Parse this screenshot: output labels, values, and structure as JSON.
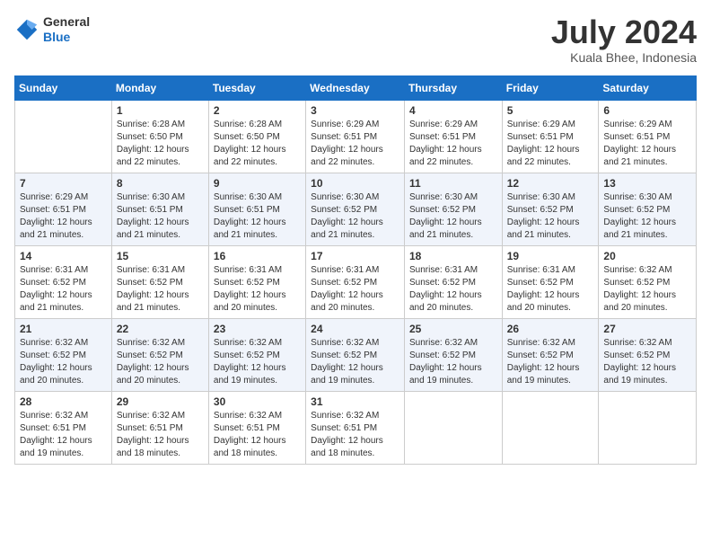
{
  "header": {
    "logo": {
      "general": "General",
      "blue": "Blue"
    },
    "title": "July 2024",
    "location": "Kuala Bhee, Indonesia"
  },
  "columns": [
    "Sunday",
    "Monday",
    "Tuesday",
    "Wednesday",
    "Thursday",
    "Friday",
    "Saturday"
  ],
  "weeks": [
    [
      {
        "num": "",
        "info": ""
      },
      {
        "num": "1",
        "info": "Sunrise: 6:28 AM\nSunset: 6:50 PM\nDaylight: 12 hours\nand 22 minutes."
      },
      {
        "num": "2",
        "info": "Sunrise: 6:28 AM\nSunset: 6:50 PM\nDaylight: 12 hours\nand 22 minutes."
      },
      {
        "num": "3",
        "info": "Sunrise: 6:29 AM\nSunset: 6:51 PM\nDaylight: 12 hours\nand 22 minutes."
      },
      {
        "num": "4",
        "info": "Sunrise: 6:29 AM\nSunset: 6:51 PM\nDaylight: 12 hours\nand 22 minutes."
      },
      {
        "num": "5",
        "info": "Sunrise: 6:29 AM\nSunset: 6:51 PM\nDaylight: 12 hours\nand 22 minutes."
      },
      {
        "num": "6",
        "info": "Sunrise: 6:29 AM\nSunset: 6:51 PM\nDaylight: 12 hours\nand 21 minutes."
      }
    ],
    [
      {
        "num": "7",
        "info": "Sunrise: 6:29 AM\nSunset: 6:51 PM\nDaylight: 12 hours\nand 21 minutes."
      },
      {
        "num": "8",
        "info": "Sunrise: 6:30 AM\nSunset: 6:51 PM\nDaylight: 12 hours\nand 21 minutes."
      },
      {
        "num": "9",
        "info": "Sunrise: 6:30 AM\nSunset: 6:51 PM\nDaylight: 12 hours\nand 21 minutes."
      },
      {
        "num": "10",
        "info": "Sunrise: 6:30 AM\nSunset: 6:52 PM\nDaylight: 12 hours\nand 21 minutes."
      },
      {
        "num": "11",
        "info": "Sunrise: 6:30 AM\nSunset: 6:52 PM\nDaylight: 12 hours\nand 21 minutes."
      },
      {
        "num": "12",
        "info": "Sunrise: 6:30 AM\nSunset: 6:52 PM\nDaylight: 12 hours\nand 21 minutes."
      },
      {
        "num": "13",
        "info": "Sunrise: 6:30 AM\nSunset: 6:52 PM\nDaylight: 12 hours\nand 21 minutes."
      }
    ],
    [
      {
        "num": "14",
        "info": "Sunrise: 6:31 AM\nSunset: 6:52 PM\nDaylight: 12 hours\nand 21 minutes."
      },
      {
        "num": "15",
        "info": "Sunrise: 6:31 AM\nSunset: 6:52 PM\nDaylight: 12 hours\nand 21 minutes."
      },
      {
        "num": "16",
        "info": "Sunrise: 6:31 AM\nSunset: 6:52 PM\nDaylight: 12 hours\nand 20 minutes."
      },
      {
        "num": "17",
        "info": "Sunrise: 6:31 AM\nSunset: 6:52 PM\nDaylight: 12 hours\nand 20 minutes."
      },
      {
        "num": "18",
        "info": "Sunrise: 6:31 AM\nSunset: 6:52 PM\nDaylight: 12 hours\nand 20 minutes."
      },
      {
        "num": "19",
        "info": "Sunrise: 6:31 AM\nSunset: 6:52 PM\nDaylight: 12 hours\nand 20 minutes."
      },
      {
        "num": "20",
        "info": "Sunrise: 6:32 AM\nSunset: 6:52 PM\nDaylight: 12 hours\nand 20 minutes."
      }
    ],
    [
      {
        "num": "21",
        "info": "Sunrise: 6:32 AM\nSunset: 6:52 PM\nDaylight: 12 hours\nand 20 minutes."
      },
      {
        "num": "22",
        "info": "Sunrise: 6:32 AM\nSunset: 6:52 PM\nDaylight: 12 hours\nand 20 minutes."
      },
      {
        "num": "23",
        "info": "Sunrise: 6:32 AM\nSunset: 6:52 PM\nDaylight: 12 hours\nand 19 minutes."
      },
      {
        "num": "24",
        "info": "Sunrise: 6:32 AM\nSunset: 6:52 PM\nDaylight: 12 hours\nand 19 minutes."
      },
      {
        "num": "25",
        "info": "Sunrise: 6:32 AM\nSunset: 6:52 PM\nDaylight: 12 hours\nand 19 minutes."
      },
      {
        "num": "26",
        "info": "Sunrise: 6:32 AM\nSunset: 6:52 PM\nDaylight: 12 hours\nand 19 minutes."
      },
      {
        "num": "27",
        "info": "Sunrise: 6:32 AM\nSunset: 6:52 PM\nDaylight: 12 hours\nand 19 minutes."
      }
    ],
    [
      {
        "num": "28",
        "info": "Sunrise: 6:32 AM\nSunset: 6:51 PM\nDaylight: 12 hours\nand 19 minutes."
      },
      {
        "num": "29",
        "info": "Sunrise: 6:32 AM\nSunset: 6:51 PM\nDaylight: 12 hours\nand 18 minutes."
      },
      {
        "num": "30",
        "info": "Sunrise: 6:32 AM\nSunset: 6:51 PM\nDaylight: 12 hours\nand 18 minutes."
      },
      {
        "num": "31",
        "info": "Sunrise: 6:32 AM\nSunset: 6:51 PM\nDaylight: 12 hours\nand 18 minutes."
      },
      {
        "num": "",
        "info": ""
      },
      {
        "num": "",
        "info": ""
      },
      {
        "num": "",
        "info": ""
      }
    ]
  ]
}
